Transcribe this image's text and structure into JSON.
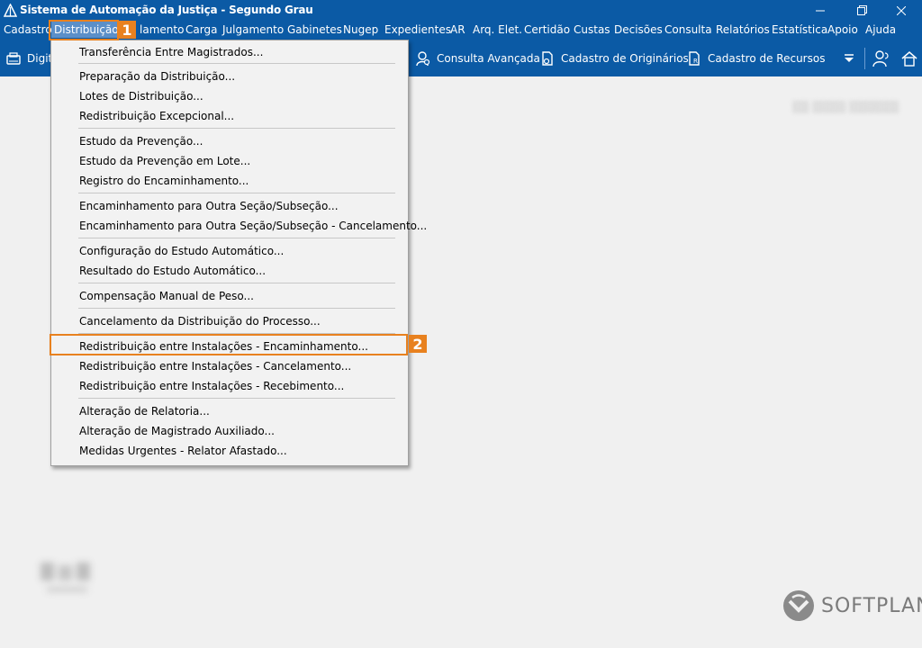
{
  "window": {
    "title": "Sistema de Automação da Justiça - Segundo Grau",
    "minimize_icon": "minimize-icon",
    "restore_icon": "restore-icon",
    "close_icon": "close-icon"
  },
  "menubar": {
    "items": [
      "Cadastro",
      "Distribuição",
      "lamento",
      "Carga",
      "Julgamento",
      "Gabinetes",
      "Nugep",
      "Expedientes",
      "AR",
      "Arq. Elet.",
      "Certidão",
      "Custas",
      "Decisões",
      "Consulta",
      "Relatórios",
      "Estatística",
      "Apoio",
      "Ajuda"
    ]
  },
  "toolbar": {
    "digit_label": "Digit",
    "consulta_avancada": "Consulta Avançada",
    "cadastro_originarios": "Cadastro de Originários",
    "cadastro_recursos": "Cadastro de Recursos"
  },
  "dropdown": {
    "items": [
      "Transferência Entre Magistrados...",
      "Preparação da Distribuição...",
      "Lotes de Distribuição...",
      "Redistribuição Excepcional...",
      "Estudo da Prevenção...",
      "Estudo da Prevenção em Lote...",
      "Registro do Encaminhamento...",
      "Encaminhamento para Outra Seção/Subseção...",
      "Encaminhamento para Outra Seção/Subseção - Cancelamento...",
      "Configuração do Estudo Automático...",
      "Resultado do Estudo Automático...",
      "Compensação Manual de Peso...",
      "Cancelamento da Distribuição do Processo...",
      "Redistribuição entre Instalações - Encaminhamento...",
      "Redistribuição entre Instalações - Cancelamento...",
      "Redistribuição entre Instalações - Recebimento...",
      "Alteração de Relatoria...",
      "Alteração de Magistrado Auxiliado...",
      "Medidas Urgentes - Relator Afastado..."
    ]
  },
  "callouts": {
    "one": "1",
    "two": "2"
  },
  "brand": {
    "softplan": "SOFTPLAN"
  },
  "colors": {
    "titlebar": "#0b5aa5",
    "accent": "#e8811f",
    "menu_highlight": "#5b8fc8"
  }
}
